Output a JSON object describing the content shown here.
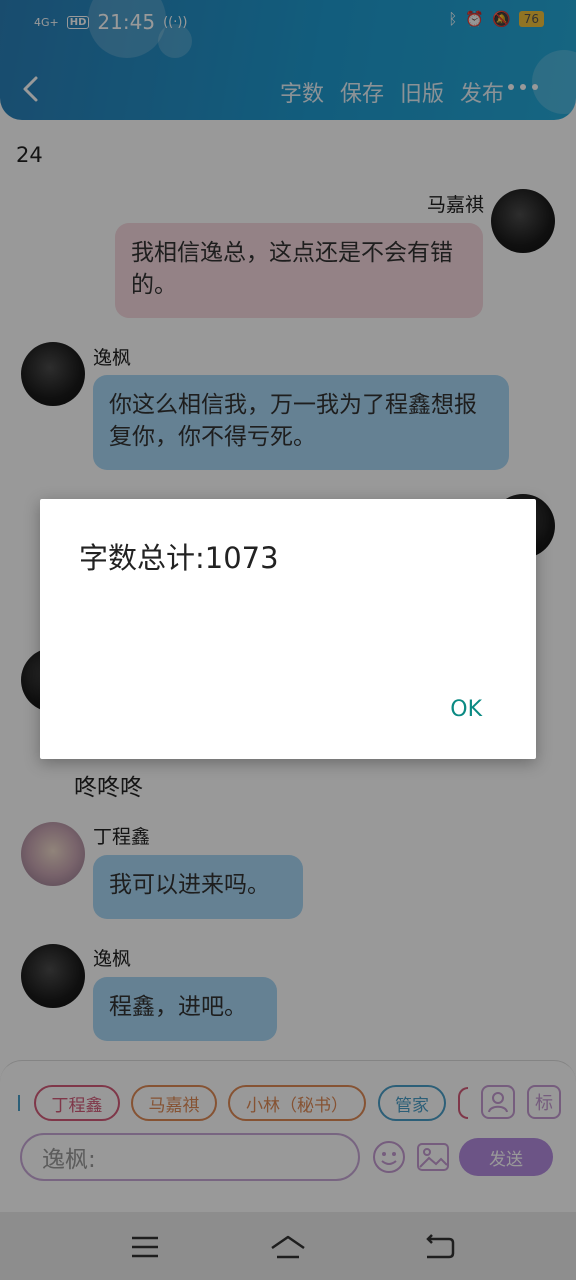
{
  "status_bar": {
    "network": "4G+",
    "hd": "HD",
    "time": "21:45",
    "battery": "76"
  },
  "header": {
    "menu": [
      "字数",
      "保存",
      "旧版",
      "发布"
    ]
  },
  "chat": {
    "count": "24",
    "messages": [
      {
        "sender": "马嘉祺",
        "text": "我相信逸总，这点还是不会有错的。"
      },
      {
        "sender": "逸枫",
        "text": "你这么相信我，万一我为了程鑫想报复你，你不得亏死。"
      },
      {
        "sender": "",
        "text": "咚咚咚"
      },
      {
        "sender": "丁程鑫",
        "text": "我可以进来吗。"
      },
      {
        "sender": "逸枫",
        "text": "程鑫，进吧。"
      }
    ]
  },
  "input_panel": {
    "chips": [
      "丁程鑫",
      "马嘉祺",
      "小林（秘书）",
      "管家"
    ],
    "tag_label": "标",
    "input_value": "逸枫:",
    "send_label": "发送"
  },
  "dialog": {
    "message": "字数总计:1073",
    "ok_label": "OK"
  }
}
